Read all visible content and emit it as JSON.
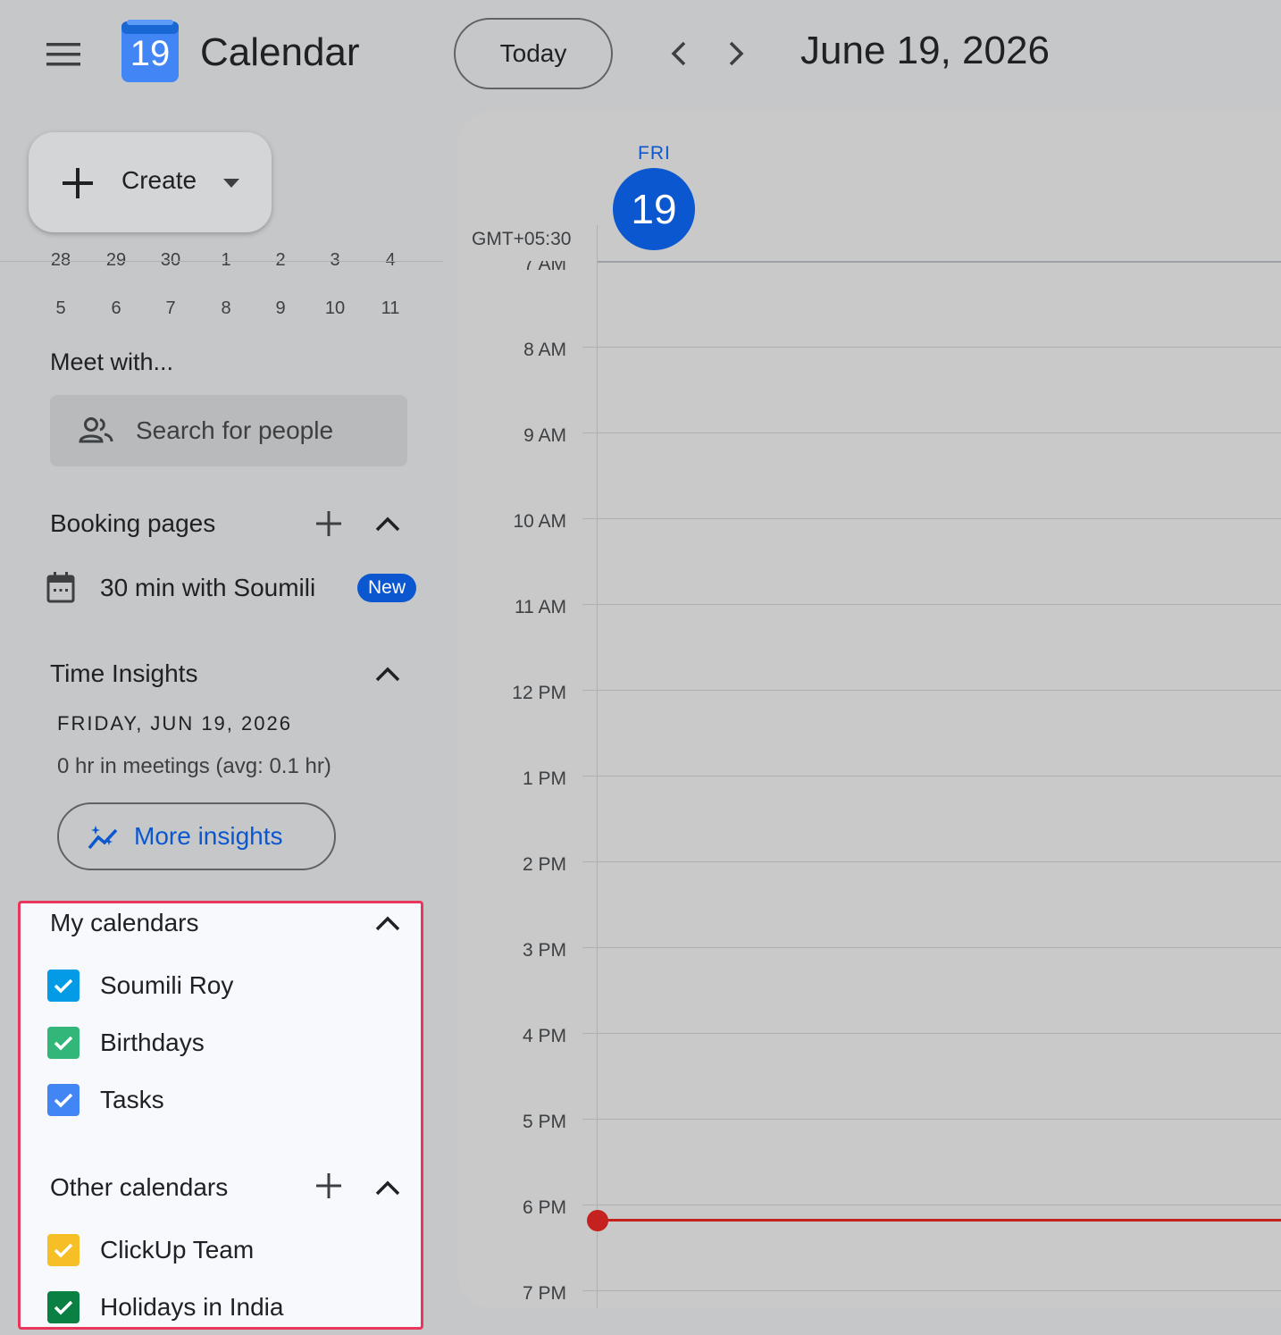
{
  "header": {
    "app_logo_day": "19",
    "app_title": "Calendar",
    "today_label": "Today",
    "current_date": "June 19, 2026"
  },
  "create": {
    "label": "Create"
  },
  "mini_calendar": {
    "partial_row": [
      "28",
      "29",
      "30",
      "1",
      "2",
      "3",
      "4"
    ],
    "last_row": [
      "5",
      "6",
      "7",
      "8",
      "9",
      "10",
      "11"
    ]
  },
  "meet_with": {
    "title": "Meet with...",
    "search_placeholder": "Search for people"
  },
  "booking_pages": {
    "title": "Booking pages",
    "item_label": "30 min with Soumili",
    "badge": "New"
  },
  "time_insights": {
    "title": "Time Insights",
    "date": "FRIDAY, JUN 19, 2026",
    "stat": "0 hr in meetings (avg: 0.1 hr)",
    "more_label": "More insights"
  },
  "my_calendars": {
    "title": "My calendars",
    "items": [
      {
        "label": "Soumili Roy",
        "color": "#039be5"
      },
      {
        "label": "Birthdays",
        "color": "#33b679"
      },
      {
        "label": "Tasks",
        "color": "#4285f4"
      }
    ]
  },
  "other_calendars": {
    "title": "Other calendars",
    "items": [
      {
        "label": "ClickUp Team",
        "color": "#f6bf26"
      },
      {
        "label": "Holidays in India",
        "color": "#0b8043"
      }
    ]
  },
  "day_view": {
    "day_of_week": "FRI",
    "day_number": "19",
    "timezone": "GMT+05:30",
    "hours": [
      "7 AM",
      "8 AM",
      "9 AM",
      "10 AM",
      "11 AM",
      "12 PM",
      "1 PM",
      "2 PM",
      "3 PM",
      "4 PM",
      "5 PM",
      "6 PM",
      "7 PM"
    ]
  },
  "colors": {
    "accent": "#0b57d0",
    "now_indicator": "#c5221f",
    "highlight_border": "#e8365d"
  }
}
